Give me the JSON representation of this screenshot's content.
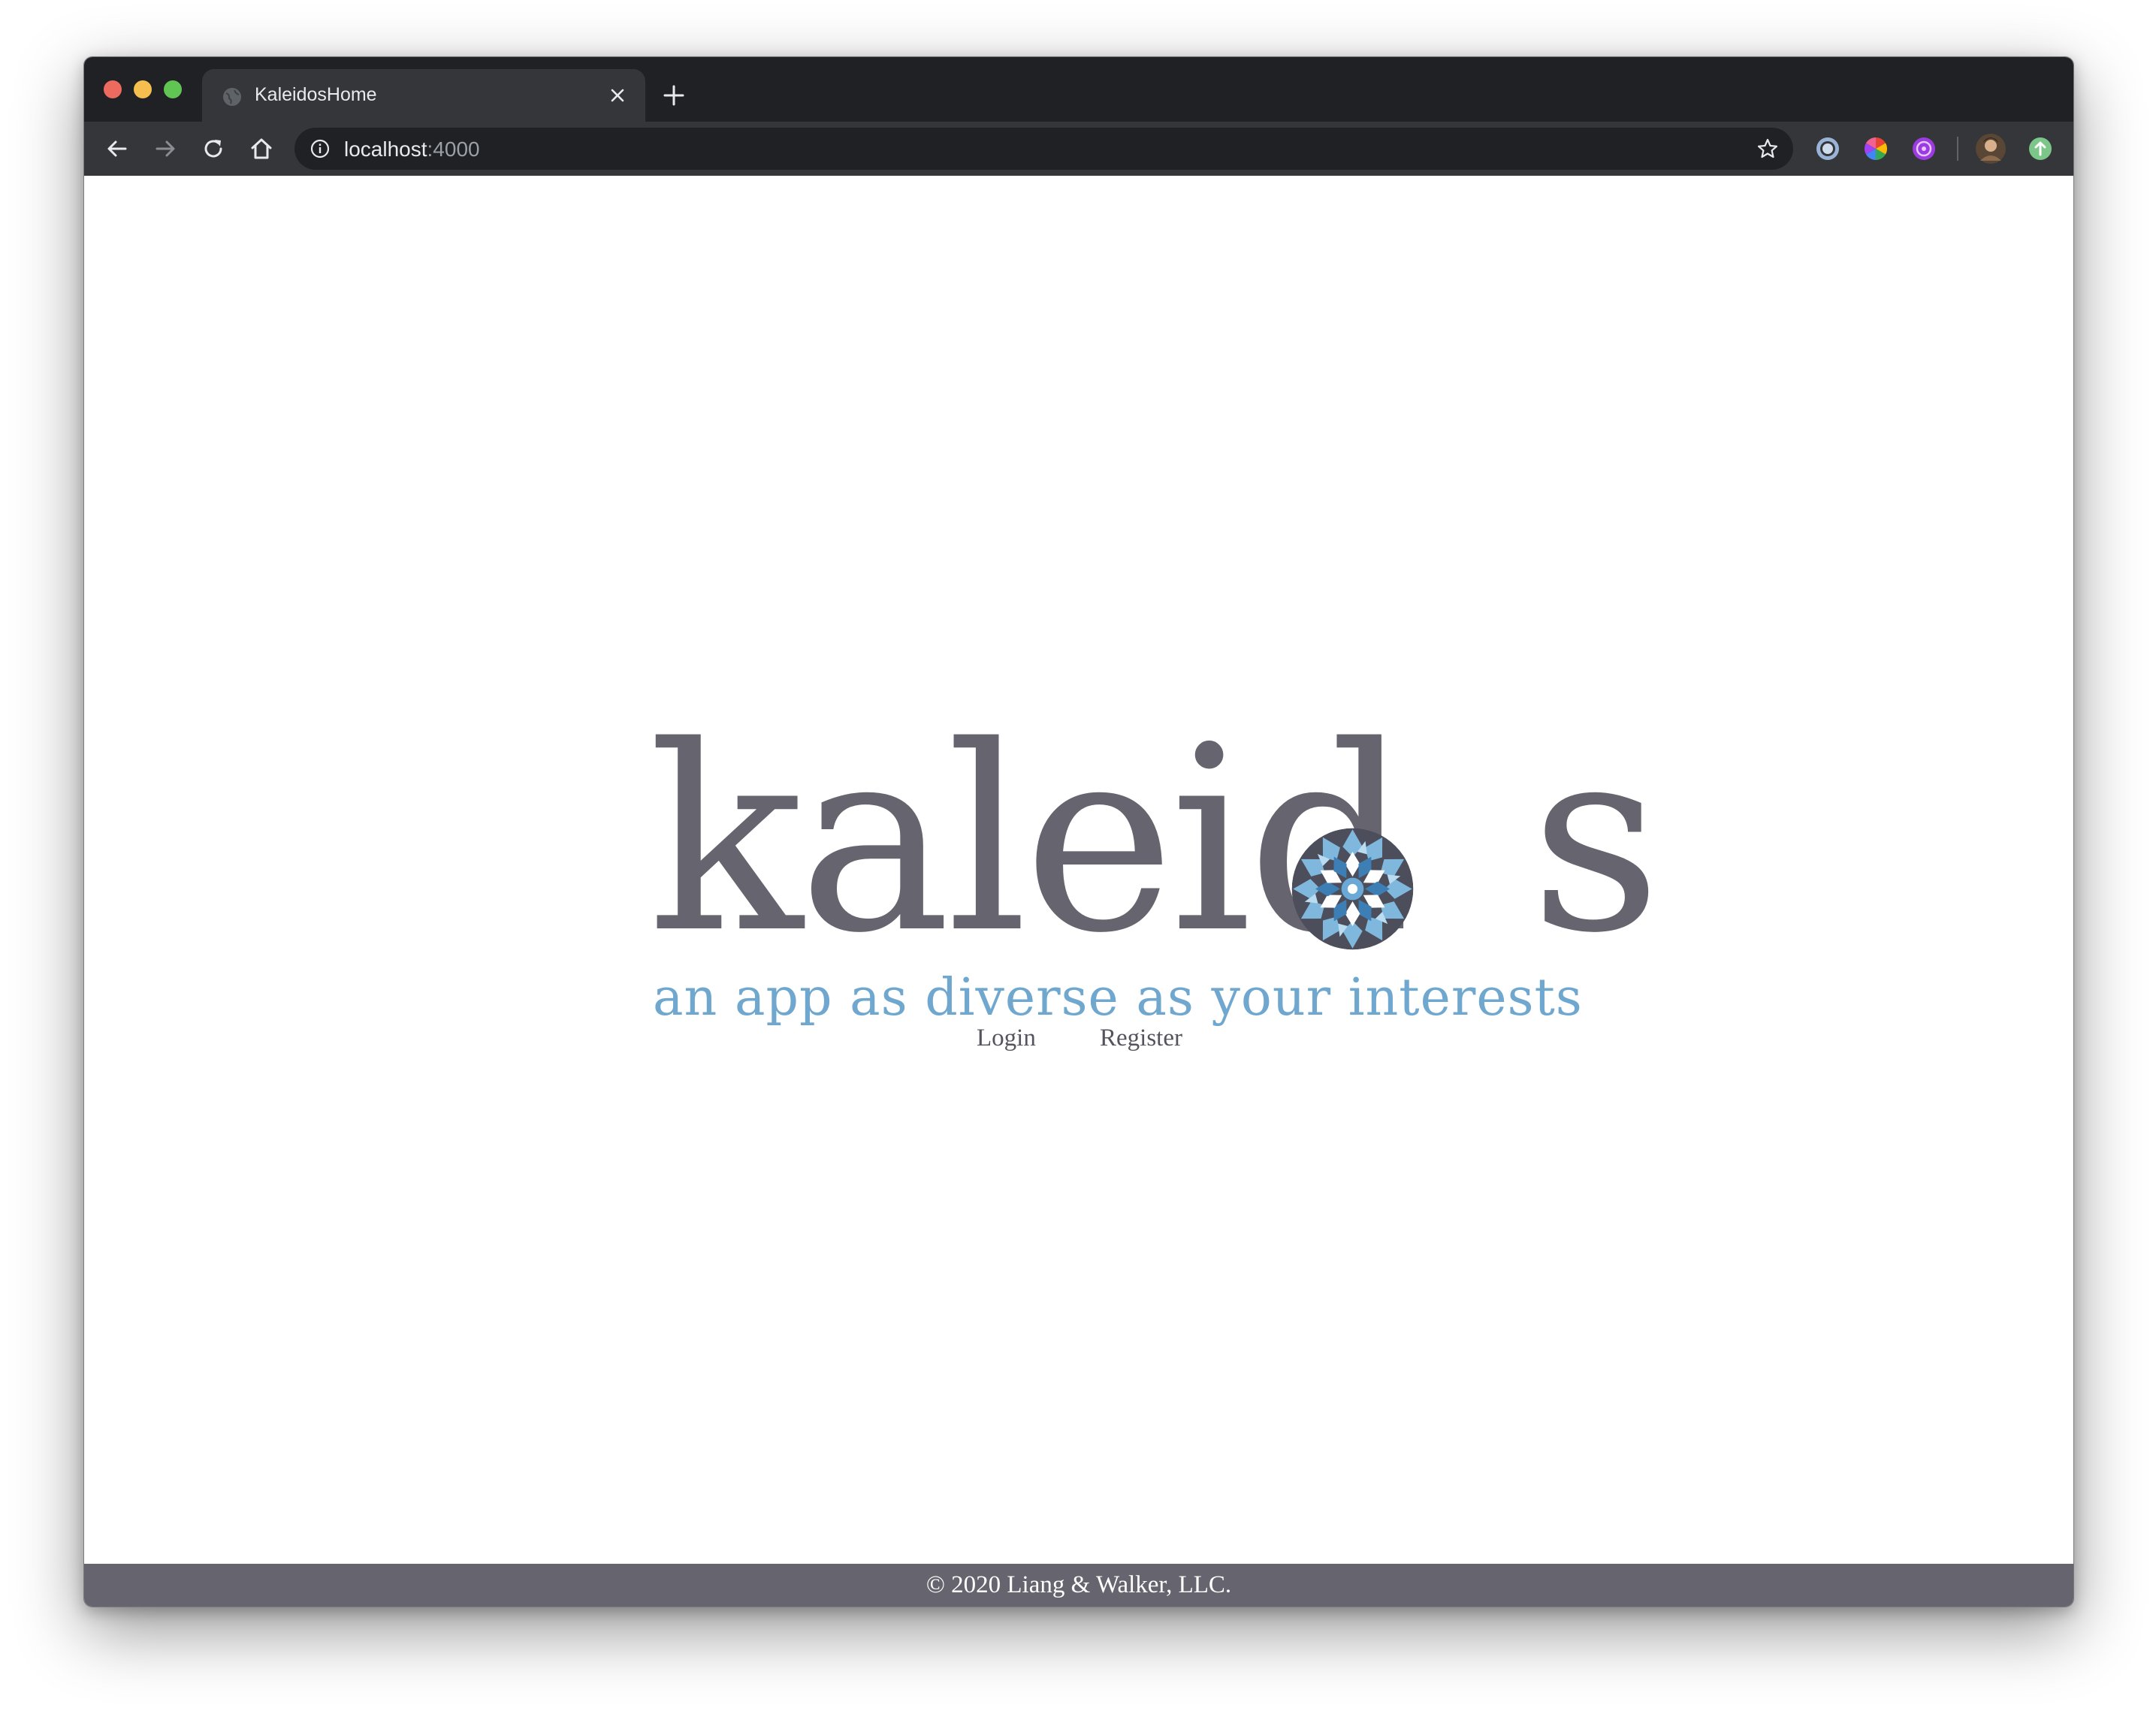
{
  "browser": {
    "tab": {
      "title": "KaleidosHome",
      "favicon_icon": "globe-icon",
      "close_icon": "close-icon"
    },
    "new_tab_icon": "plus-icon",
    "nav": {
      "back_icon": "arrow-left-icon",
      "forward_icon": "arrow-right-icon",
      "reload_icon": "reload-icon",
      "home_icon": "home-icon"
    },
    "address": {
      "host": "localhost",
      "port": ":4000",
      "info_icon": "info-icon",
      "bookmark_icon": "star-icon"
    },
    "extensions": [
      "ring-extension-icon",
      "color-wheel-extension-icon",
      "purple-extension-icon",
      "profile-avatar",
      "green-upload-extension-icon"
    ]
  },
  "page": {
    "logo": {
      "wordmark_before": "kaleid",
      "wordmark_after": "s",
      "emblem_icon": "kaleidoscope-mandala-icon",
      "tagline": "an app as diverse as your interests"
    },
    "links": {
      "login": "Login",
      "register": "Register"
    },
    "footer": {
      "copyright": "© 2020 Liang & Walker, LLC."
    }
  },
  "colors": {
    "wordmark": "#66656f",
    "tagline": "#6fa7cf",
    "footer_bg": "#66656f",
    "browser_frame": "#202124",
    "toolbar": "#35363a"
  }
}
